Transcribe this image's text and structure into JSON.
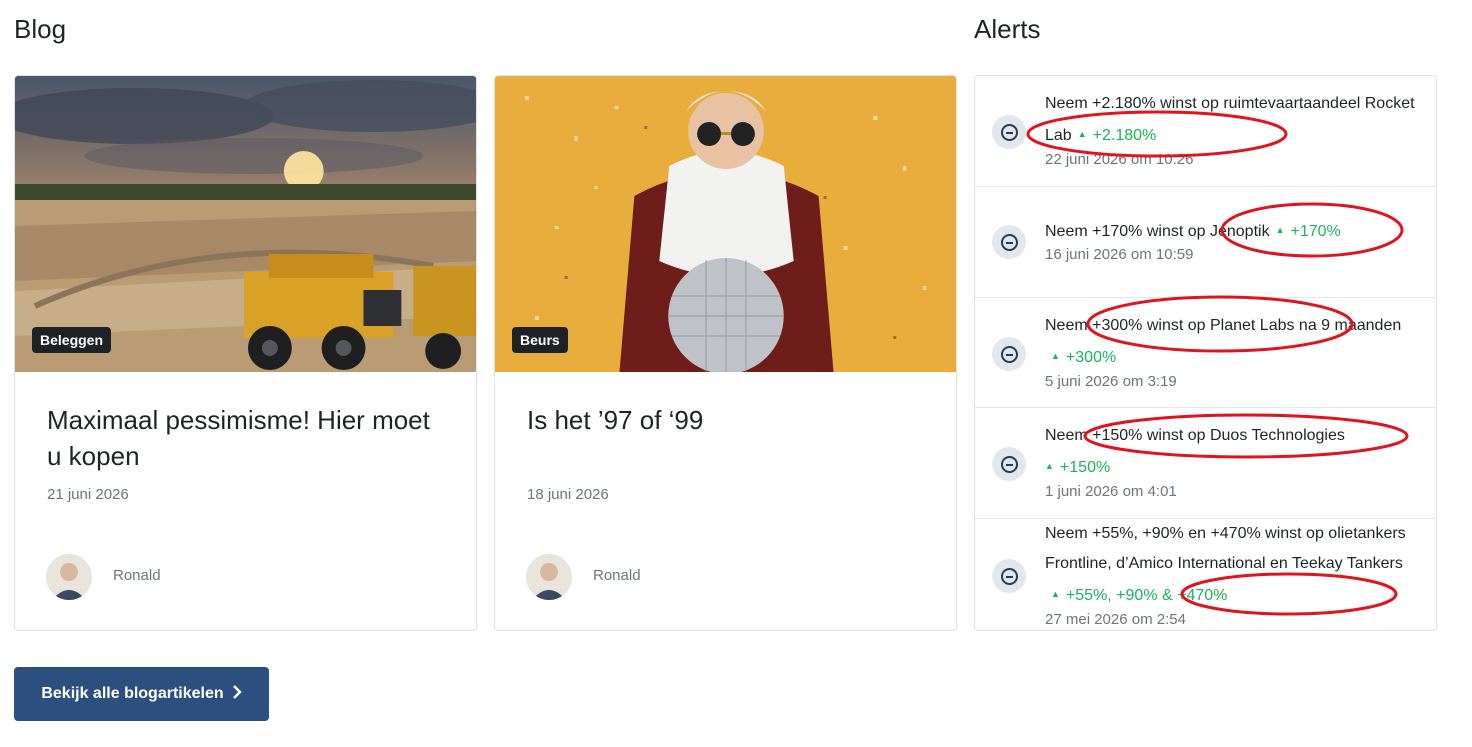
{
  "blog": {
    "title": "Blog",
    "button_label": "Bekijk alle blogartikelen",
    "button_icon": "chevron-right-icon",
    "cards": [
      {
        "category": "Beleggen",
        "title": "Maximaal pessimisme! Hier moet u kopen",
        "date": "21 juni 2026",
        "author": "Ronald"
      },
      {
        "category": "Beurs",
        "title": "Is het ’97 of ‘99",
        "date": "18 juni 2026",
        "author": "Ronald"
      }
    ]
  },
  "alerts": {
    "title": "Alerts",
    "icon": "minus-circle-icon",
    "items": [
      {
        "text": "Neem +2.180% winst op ruimtevaartaandeel Rocket Lab",
        "gain": "+2.180%",
        "date": "22 juni 2026 om 10:26"
      },
      {
        "text": "Neem +170% winst op Jenoptik",
        "gain": "+170%",
        "date": "16 juni 2026 om 10:59"
      },
      {
        "text": "Neem +300% winst op Planet Labs na 9 maanden",
        "gain": "+300%",
        "date": "5 juni 2026 om 3:19"
      },
      {
        "text": "Neem +150% winst op Duos Technologies",
        "gain": "+150%",
        "date": "1 juni 2026 om 4:01"
      },
      {
        "text": "Neem +55%, +90% en +470% winst op olietankers Frontline, d’Amico International en Teekay Tankers",
        "gain": "+55%, +90% & +470%",
        "date": "27 mei 2026 om 2:54"
      }
    ]
  },
  "colors": {
    "gain": "#1eb35a",
    "button": "#2c4f80",
    "annotation": "#e0141e",
    "badge": "#1e2126"
  }
}
